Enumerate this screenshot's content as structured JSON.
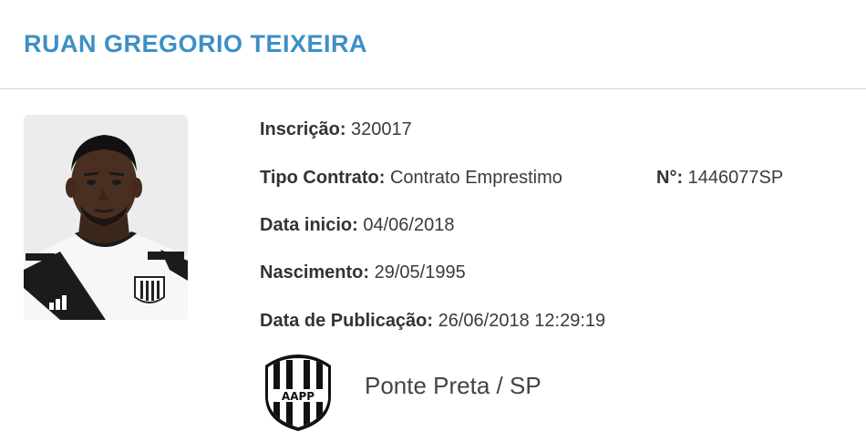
{
  "player": {
    "name": "RUAN GREGORIO TEIXEIRA"
  },
  "details": {
    "inscricao_label": "Inscrição:",
    "inscricao_value": "320017",
    "tipo_contrato_label": "Tipo Contrato:",
    "tipo_contrato_value": "Contrato Emprestimo",
    "numero_label": "N°:",
    "numero_value": "1446077SP",
    "data_inicio_label": "Data inicio:",
    "data_inicio_value": "04/06/2018",
    "nascimento_label": "Nascimento:",
    "nascimento_value": "29/05/1995",
    "data_publicacao_label": "Data de Publicação:",
    "data_publicacao_value": "26/06/2018 12:29:19"
  },
  "club": {
    "name": "Ponte Preta / SP",
    "crest_text": "AAPP",
    "crest_icon": "club-crest-icon"
  },
  "colors": {
    "title": "#3d8fc6",
    "text": "#333333",
    "divider": "#d9d9d9"
  }
}
